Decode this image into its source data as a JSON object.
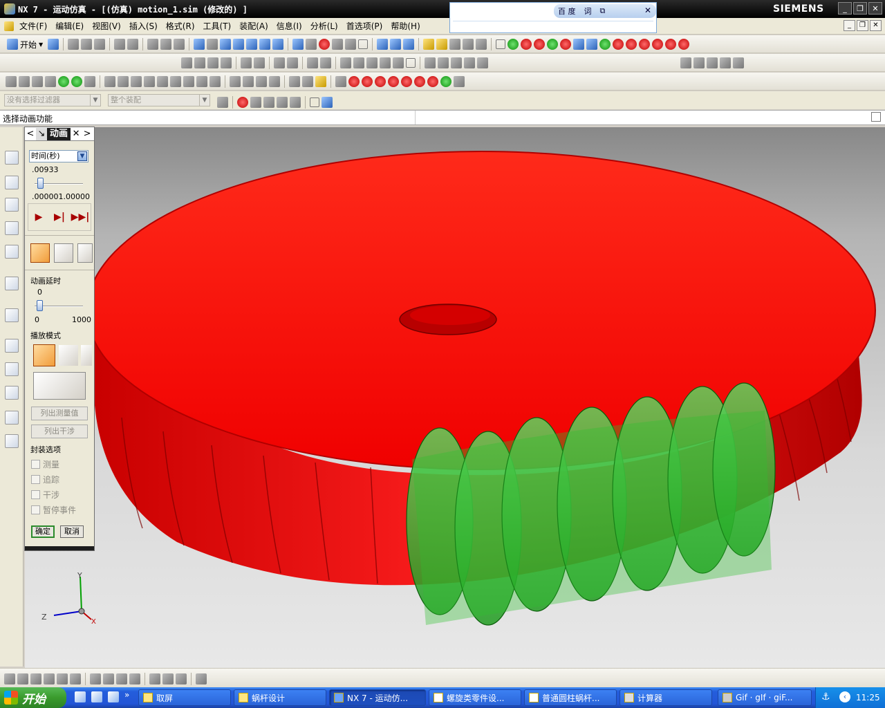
{
  "window": {
    "title": "NX 7 - 运动仿真 - [(仿真) motion_1.sim  (修改的) ]",
    "brand": "SIEMENS",
    "controls": [
      "_",
      "❐",
      "✕"
    ]
  },
  "baidu_toolbar": {
    "label": "百 度",
    "ci": "词",
    "copy": "⧉",
    "close": "✕"
  },
  "menu": [
    "文件(F)",
    "编辑(E)",
    "视图(V)",
    "插入(S)",
    "格式(R)",
    "工具(T)",
    "装配(A)",
    "信息(I)",
    "分析(L)",
    "首选项(P)",
    "帮助(H)"
  ],
  "toolbar": {
    "start_label": "开始"
  },
  "filter": {
    "selection_filter_placeholder": "没有选择过滤器",
    "assembly_scope": "整个装配"
  },
  "cue_line": "选择动画功能",
  "dialog": {
    "title": "动画",
    "time_unit": "时间(秒)",
    "time_value": ".00933",
    "slider_range": ".000001.00000",
    "time_fraction": 0.00933,
    "delay_label": "动画延时",
    "delay_value": "0",
    "delay_min": "0",
    "delay_max": "1000",
    "play_mode_label": "播放模式",
    "list_measure": "列出测量值",
    "list_interference": "列出干涉",
    "envelope_label": "封装选项",
    "check_measure": "测量",
    "check_trace": "追踪",
    "check_interference": "干涉",
    "check_pause": "暂停事件",
    "ok": "确定",
    "cancel": "取消"
  },
  "triad": {
    "y": "Y",
    "z": "Z",
    "x": "X"
  },
  "taskbar": {
    "start": "开始",
    "tasks": [
      "取屏",
      "蜗杆设计",
      "NX 7 - 运动仿...",
      "螺旋类零件设...",
      "普通圆柱蜗杆...",
      "计算器",
      "Gif · gIf · giF..."
    ],
    "clock": "11:25"
  },
  "colors": {
    "gear": "#ff1414",
    "worm": "#2fbf2f",
    "accent": "#245edc"
  }
}
